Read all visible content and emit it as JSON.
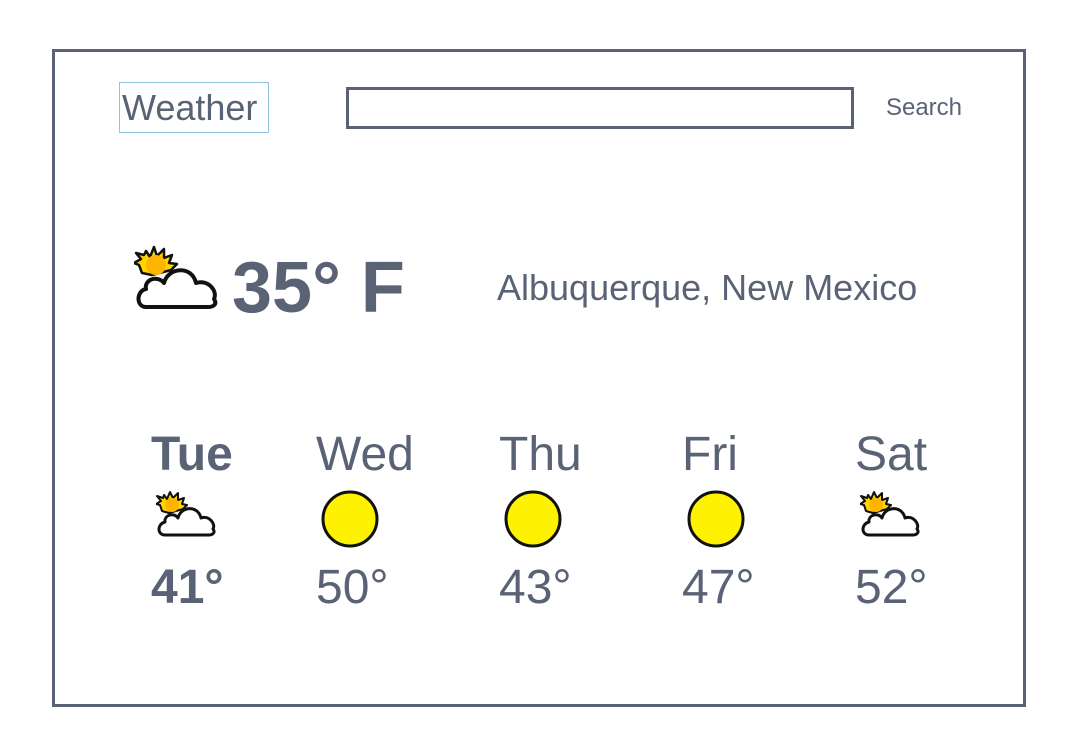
{
  "app": {
    "title": "Weather"
  },
  "search": {
    "value": "",
    "placeholder": "",
    "button_label": "Search"
  },
  "current": {
    "icon": "partly-cloudy-icon",
    "temperature": "35° F",
    "location": "Albuquerque, New Mexico"
  },
  "forecast": [
    {
      "day": "Tue",
      "icon": "partly-cloudy-icon",
      "temp": "41°",
      "selected": true
    },
    {
      "day": "Wed",
      "icon": "sun-icon",
      "temp": "50°",
      "selected": false
    },
    {
      "day": "Thu",
      "icon": "sun-icon",
      "temp": "43°",
      "selected": false
    },
    {
      "day": "Fri",
      "icon": "sun-icon",
      "temp": "47°",
      "selected": false
    },
    {
      "day": "Sat",
      "icon": "partly-cloudy-icon",
      "temp": "52°",
      "selected": false
    }
  ],
  "colors": {
    "text": "#5a6275",
    "sun": "#fff200",
    "sun_outline": "#111111",
    "title_border": "#8ec3e8"
  }
}
